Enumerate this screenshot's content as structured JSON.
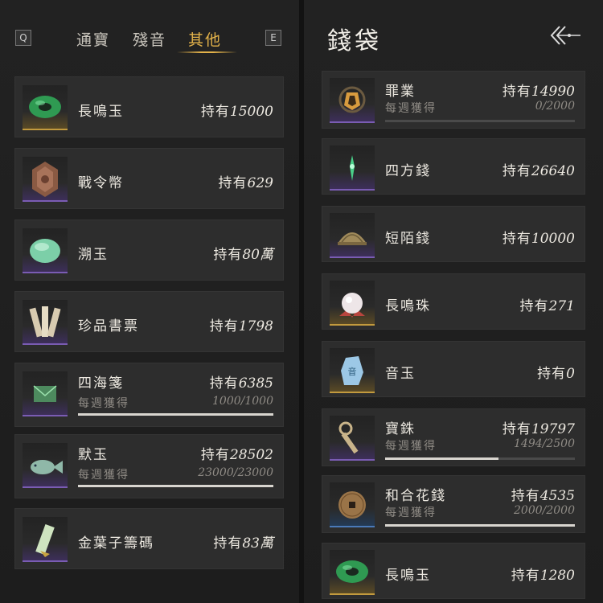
{
  "tabs": {
    "key_left": "Q",
    "key_right": "E",
    "items": [
      {
        "label": "通寶"
      },
      {
        "label": "殘音"
      },
      {
        "label": "其他",
        "active": true
      }
    ],
    "active_color": "#e3b24a"
  },
  "left_items": [
    {
      "name": "長鳴玉",
      "hold_label": "持有",
      "hold_value": "15000",
      "icon": "jade-ring-icon",
      "rarity": "gold"
    },
    {
      "name": "戰令幣",
      "hold_label": "持有",
      "hold_value": "629",
      "icon": "bronze-token-icon",
      "rarity": "purple"
    },
    {
      "name": "溯玉",
      "hold_label": "持有",
      "hold_value": "80萬",
      "icon": "jade-stone-icon",
      "rarity": "purple"
    },
    {
      "name": "珍品書票",
      "hold_label": "持有",
      "hold_value": "1798",
      "icon": "book-tickets-icon",
      "rarity": "purple"
    },
    {
      "name": "四海箋",
      "hold_label": "持有",
      "hold_value": "6385",
      "icon": "letter-paper-icon",
      "rarity": "purple",
      "weekly_label": "每週獲得",
      "weekly_value": "1000/1000",
      "progress": 1.0
    },
    {
      "name": "默玉",
      "hold_label": "持有",
      "hold_value": "28502",
      "icon": "jade-fish-icon",
      "rarity": "purple",
      "weekly_label": "每週獲得",
      "weekly_value": "23000/23000",
      "progress": 1.0
    },
    {
      "name": "金葉子籌碼",
      "hold_label": "持有",
      "hold_value": "83萬",
      "icon": "gold-leaf-chip-icon",
      "rarity": "purple"
    }
  ],
  "wallet": {
    "title": "錢袋",
    "back_icon": "back-arrow-icon"
  },
  "right_items": [
    {
      "name": "罪業",
      "hold_label": "持有",
      "hold_value": "14990",
      "icon": "sin-badge-icon",
      "rarity": "purple",
      "weekly_label": "每週獲得",
      "weekly_value": "0/2000",
      "progress": 0.0
    },
    {
      "name": "四方錢",
      "hold_label": "持有",
      "hold_value": "26640",
      "icon": "green-spark-icon",
      "rarity": "purple"
    },
    {
      "name": "短陌錢",
      "hold_label": "持有",
      "hold_value": "10000",
      "icon": "coin-stack-icon",
      "rarity": "purple"
    },
    {
      "name": "長鳴珠",
      "hold_label": "持有",
      "hold_value": "271",
      "icon": "pearl-icon",
      "rarity": "gold"
    },
    {
      "name": "音玉",
      "hold_label": "持有",
      "hold_value": "0",
      "icon": "sound-jade-icon",
      "rarity": "gold"
    },
    {
      "name": "寶銖",
      "hold_label": "持有",
      "hold_value": "19797",
      "icon": "key-coin-icon",
      "rarity": "purple",
      "weekly_label": "每週獲得",
      "weekly_value": "1494/2500",
      "progress": 0.5976
    },
    {
      "name": "和合花錢",
      "hold_label": "持有",
      "hold_value": "4535",
      "icon": "flower-coin-icon",
      "rarity": "blue",
      "weekly_label": "每週獲得",
      "weekly_value": "2000/2000",
      "progress": 1.0
    },
    {
      "name": "長鳴玉",
      "hold_label": "持有",
      "hold_value": "1280",
      "icon": "jade-ring-icon",
      "rarity": "gold"
    }
  ]
}
